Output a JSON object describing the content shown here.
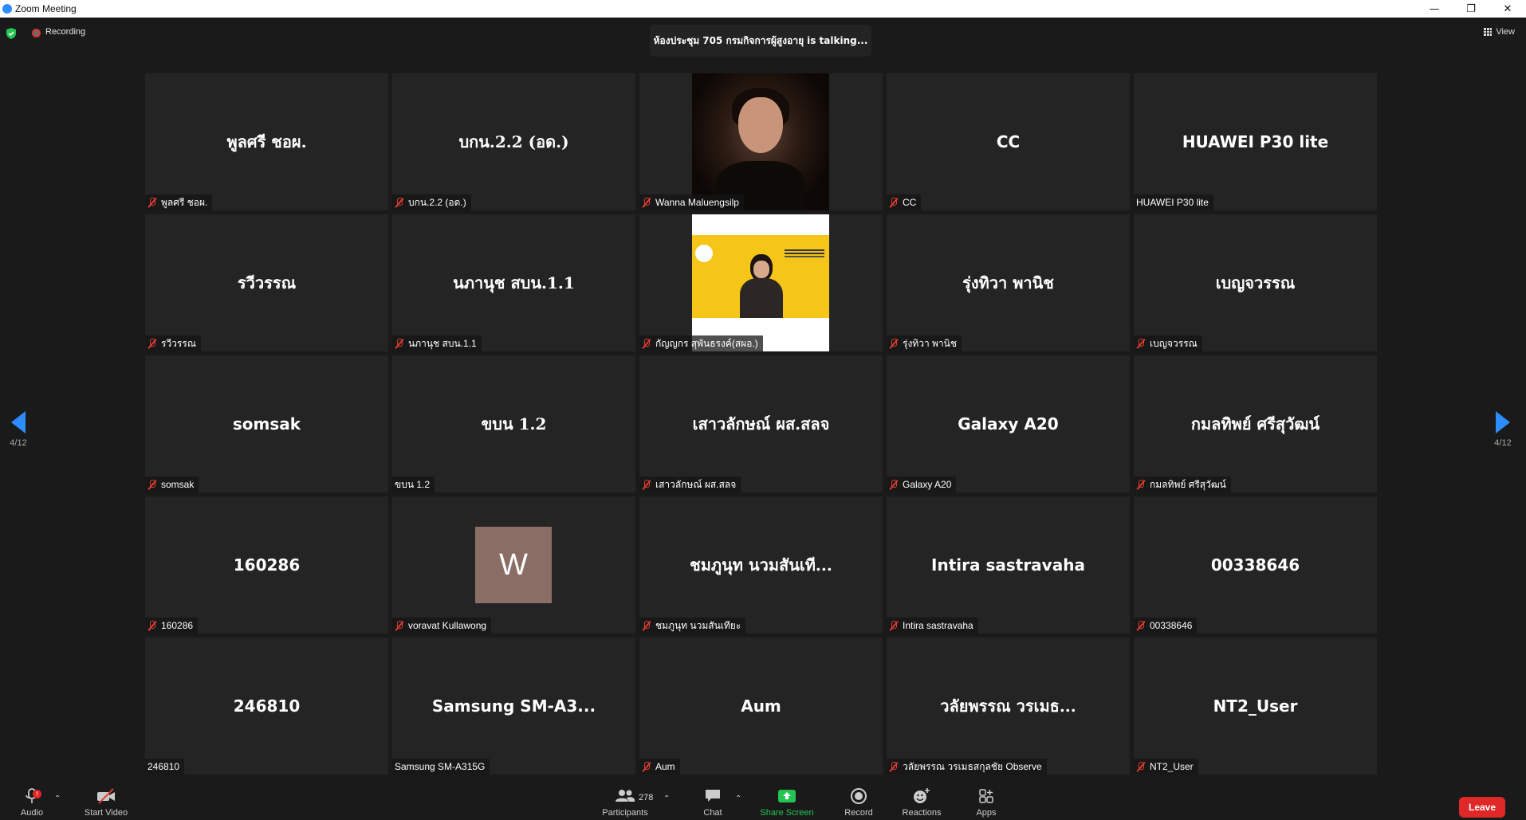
{
  "window": {
    "title": "Zoom Meeting",
    "controls": [
      "—",
      "❐",
      "✕"
    ]
  },
  "top": {
    "recording_label": "Recording",
    "talking_name": "ห้องประชุม 705 กรมกิจการผู้สูงอายุ",
    "talking_suffix": "is  talking...",
    "view_label": "View"
  },
  "pager": {
    "left_page": "4/12",
    "right_page": "4/12"
  },
  "tiles": [
    {
      "center": "พูลศรี ชอผ.",
      "label": "พูลศรี ชอผ.",
      "muted": true
    },
    {
      "center": "บกน.2.2 (อด.)",
      "label": "บกน.2.2 (อด.)",
      "muted": true
    },
    {
      "video": "dark-portrait",
      "label": "Wanna Maluengsilp",
      "muted": true
    },
    {
      "center": "CC",
      "label": "CC",
      "muted": true
    },
    {
      "center": "HUAWEI P30 lite",
      "label": "HUAWEI P30 lite",
      "muted": false
    },
    {
      "center": "รวีวรรณ",
      "label": "รวีวรรณ",
      "muted": true
    },
    {
      "center": "นภานุช สบน.1.1",
      "label": "นภานุช สบน.1.1",
      "muted": true
    },
    {
      "video": "yellow-presentation",
      "label": "กัญญกร สุพันธรงค์(สผอ.)",
      "muted": true
    },
    {
      "center": "รุ่งทิวา  พานิช",
      "label": "รุ่งทิวา  พานิช",
      "muted": true
    },
    {
      "center": "เบญจวรรณ",
      "label": "เบญจวรรณ",
      "muted": true
    },
    {
      "center": "somsak",
      "label": "somsak",
      "muted": true
    },
    {
      "center": "ขบน 1.2",
      "label": "ขบน 1.2",
      "muted": false
    },
    {
      "center": "เสาวลักษณ์ ผส.สลจ",
      "label": "เสาวลักษณ์ ผส.สลจ",
      "muted": true
    },
    {
      "center": "Galaxy A20",
      "label": "Galaxy A20",
      "muted": true
    },
    {
      "center": "กมลทิพย์ ศรีสุวัฒน์",
      "label": "กมลทิพย์ ศรีสุวัฒน์",
      "muted": true
    },
    {
      "center": "160286",
      "label": "160286",
      "muted": true
    },
    {
      "avatar": "W",
      "label": "voravat Kullawong",
      "muted": true
    },
    {
      "center": "ชมภูนุท นวมสันเที...",
      "label": "ชมภูนุท นวมสันเทียะ",
      "muted": true
    },
    {
      "center": "Intira sastravaha",
      "label": "Intira sastravaha",
      "muted": true
    },
    {
      "center": "00338646",
      "label": "00338646",
      "muted": true
    },
    {
      "center": "246810",
      "label": "246810",
      "muted": false
    },
    {
      "center": "Samsung  SM-A3...",
      "label": "Samsung SM-A315G",
      "muted": false
    },
    {
      "center": "Aum",
      "label": "Aum",
      "muted": true
    },
    {
      "center": "วลัยพรรณ วรเมธ...",
      "label": "วลัยพรรณ วรเมธสกุลชัย Observe",
      "muted": true
    },
    {
      "center": "NT2_User",
      "label": "NT2_User",
      "muted": true
    }
  ],
  "toolbar": {
    "audio": "Audio",
    "audio_badge": "!",
    "start_video": "Start Video",
    "participants": "Participants",
    "participants_count": "278",
    "chat": "Chat",
    "share_screen": "Share Screen",
    "record": "Record",
    "reactions": "Reactions",
    "apps": "Apps",
    "leave": "Leave"
  },
  "colors": {
    "accent": "#2d8cff",
    "leave": "#e02828",
    "share": "#23c552",
    "mute": "#e03c31"
  }
}
